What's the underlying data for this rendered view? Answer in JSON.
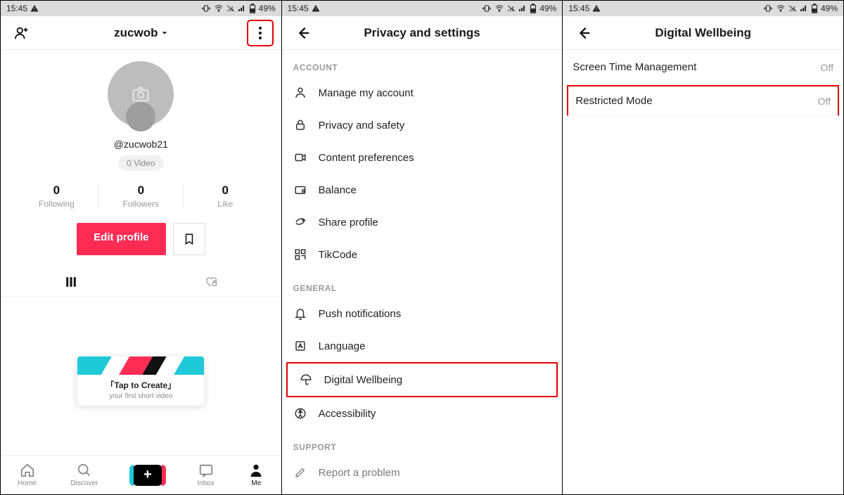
{
  "status": {
    "time": "15:45",
    "battery": "49%"
  },
  "profile": {
    "username": "zucwob",
    "handle": "@zucwob21",
    "videos_label": "0 Video",
    "stats": [
      {
        "value": "0",
        "label": "Following"
      },
      {
        "value": "0",
        "label": "Followers"
      },
      {
        "value": "0",
        "label": "Like"
      }
    ],
    "edit": "Edit profile",
    "tap_title": "「Tap to Create」",
    "tap_sub": "your first short video"
  },
  "nav": {
    "home": "Home",
    "discover": "Discover",
    "inbox": "Inbox",
    "me": "Me"
  },
  "settings": {
    "title": "Privacy and settings",
    "sections": {
      "account": "ACCOUNT",
      "general": "GENERAL",
      "support": "SUPPORT"
    },
    "items": {
      "manage": "Manage my account",
      "privacy": "Privacy and safety",
      "content": "Content preferences",
      "balance": "Balance",
      "share": "Share profile",
      "tikcode": "TikCode",
      "push": "Push notifications",
      "language": "Language",
      "digital": "Digital Wellbeing",
      "accessibility": "Accessibility",
      "report": "Report a problem"
    }
  },
  "wellbeing": {
    "title": "Digital Wellbeing",
    "rows": [
      {
        "label": "Screen Time Management",
        "value": "Off"
      },
      {
        "label": "Restricted Mode",
        "value": "Off"
      }
    ]
  }
}
